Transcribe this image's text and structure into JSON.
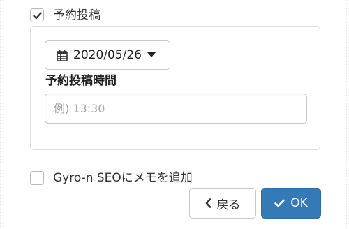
{
  "schedule": {
    "checkbox_label": "予約投稿",
    "checked": true
  },
  "date_picker": {
    "value": "2020/05/26"
  },
  "time": {
    "label": "予約投稿時間",
    "placeholder": "例) 13:30",
    "value": ""
  },
  "seo_memo": {
    "checkbox_label": "Gyro-n SEOにメモを追加",
    "checked": false
  },
  "buttons": {
    "back_label": "戻る",
    "ok_label": "OK"
  },
  "colors": {
    "primary": "#337ab7",
    "text": "#333333",
    "border": "#c9c9c9",
    "placeholder": "#a8a8a8"
  },
  "icons": {
    "schedule_check": "checkmark-icon",
    "date": "calendar-icon",
    "dropdown": "caret-down-icon",
    "back": "chevron-left-icon",
    "ok": "checkmark-icon"
  }
}
